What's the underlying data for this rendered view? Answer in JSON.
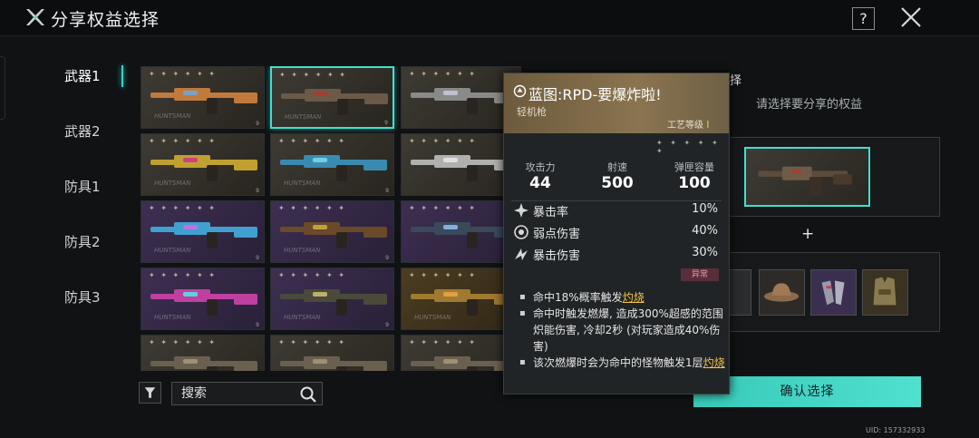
{
  "header": {
    "title": "分享权益选择",
    "help_label": "?"
  },
  "nav": [
    {
      "label": "武器1",
      "active": true
    },
    {
      "label": "武器2",
      "active": false
    },
    {
      "label": "防具1",
      "active": false
    },
    {
      "label": "防具2",
      "active": false
    },
    {
      "label": "防具3",
      "active": false
    }
  ],
  "grid": {
    "cards": [
      {
        "brand": "HUNTSMAN",
        "level": "9",
        "bg": "brown",
        "gun_color": "#c07a3c",
        "accent": "#7aa2c8"
      },
      {
        "brand": "HUNTSMAN",
        "level": "9",
        "bg": "brown",
        "gun_color": "#6b5a48",
        "accent": "#a04030",
        "selected": true
      },
      {
        "brand": "",
        "level": "",
        "bg": "brown",
        "gun_color": "#8a8a8a",
        "accent": "#c0c0d0"
      },
      {
        "brand": "HUNTSMAN",
        "level": "9",
        "bg": "brown",
        "gun_color": "#c0a030",
        "accent": "#d04080"
      },
      {
        "brand": "HUNTSMAN",
        "level": "9",
        "bg": "brown",
        "gun_color": "#3a8ab0",
        "accent": "#70d0e0"
      },
      {
        "brand": "",
        "level": "",
        "bg": "brown",
        "gun_color": "#b0b0b0",
        "accent": "#e0e0e0"
      },
      {
        "brand": "HUNTSMAN",
        "level": "9",
        "bg": "purple",
        "gun_color": "#40a0d0",
        "accent": "#c070e0"
      },
      {
        "brand": "HUNTSMAN",
        "level": "9",
        "bg": "purple",
        "gun_color": "#6a4a2a",
        "accent": "#c0a040"
      },
      {
        "brand": "",
        "level": "",
        "bg": "purple",
        "gun_color": "#3a4a5a",
        "accent": "#80b0e0"
      },
      {
        "brand": "HUNTSMAN",
        "level": "9",
        "bg": "purple",
        "gun_color": "#c040a0",
        "accent": "#60d0e0"
      },
      {
        "brand": "HUNTSMAN",
        "level": "9",
        "bg": "purple",
        "gun_color": "#4a4a3a",
        "accent": "#c0b070"
      },
      {
        "brand": "HUNTSMAN",
        "level": "",
        "bg": "gold",
        "gun_color": "#a07a30",
        "accent": "#e0a040"
      },
      {
        "brand": "",
        "level": "",
        "bg": "brown",
        "gun_color": "#6a6050",
        "accent": "#a09070"
      },
      {
        "brand": "",
        "level": "",
        "bg": "brown",
        "gun_color": "#6a6050",
        "accent": "#a09070"
      },
      {
        "brand": "",
        "level": "",
        "bg": "brown",
        "gun_color": "#6a6050",
        "accent": "#a09070"
      }
    ]
  },
  "search": {
    "placeholder": "搜索"
  },
  "right": {
    "title_visible": "权益选择",
    "hint": "请选择要分享的权益",
    "plus": "+",
    "confirm_label": "确认选择"
  },
  "tooltip": {
    "name": "蓝图:RPD-要爆炸啦!",
    "type": "轻机枪",
    "craft_label": "工艺等级",
    "craft_value": "I",
    "stats": [
      {
        "label": "攻击力",
        "value": "44"
      },
      {
        "label": "射速",
        "value": "500"
      },
      {
        "label": "弹匣容量",
        "value": "100"
      }
    ],
    "rows": [
      {
        "icon": "crit-rate-icon",
        "label": "暴击率",
        "value": "10%"
      },
      {
        "icon": "weakspot-icon",
        "label": "弱点伤害",
        "value": "40%"
      },
      {
        "icon": "crit-damage-icon",
        "label": "暴击伤害",
        "value": "30%"
      }
    ],
    "badge": "异常",
    "desc": [
      {
        "pre": "命中18%概率触发",
        "hl": "灼烧",
        "post": ""
      },
      {
        "pre": "命中时触发燃爆, 造成300%超感的范围炽能伤害, 冷却2秒 (对玩家造成40%伤害)",
        "hl": "",
        "post": ""
      },
      {
        "pre": "该次燃爆时会为命中的怪物触发1层",
        "hl": "灼烧",
        "post": ""
      }
    ]
  },
  "uid": "UID: 157332933",
  "colors": {
    "accent": "#3fe0d0",
    "highlight": "#f0c34a"
  }
}
